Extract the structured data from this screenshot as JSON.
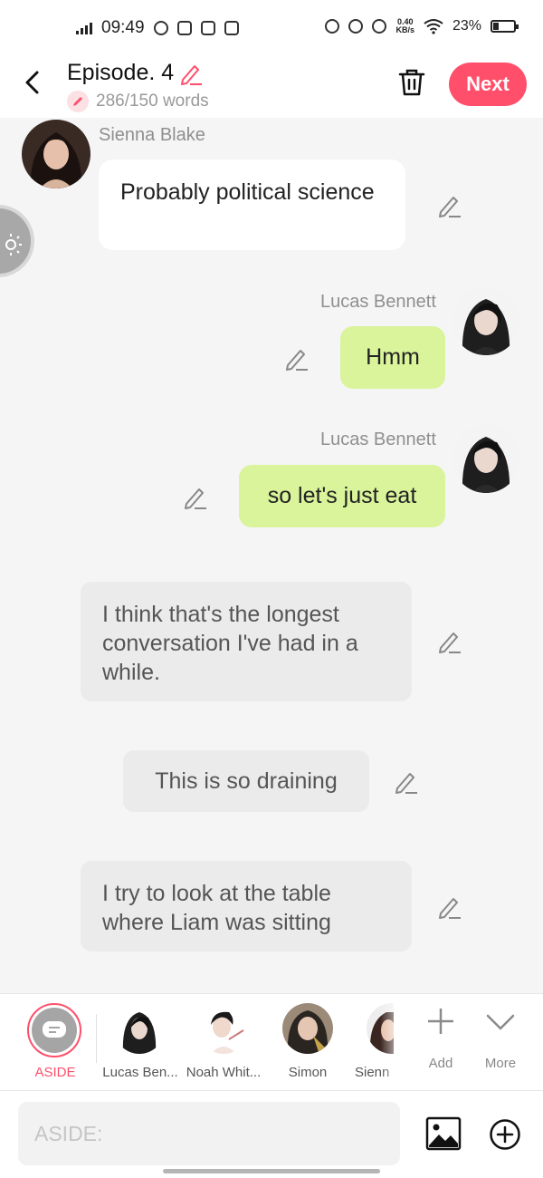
{
  "status_bar": {
    "time": "09:49",
    "net_speed_value": "0.40",
    "net_speed_unit": "KB/s",
    "battery": "23%"
  },
  "header": {
    "title": "Episode. 4",
    "word_count": "286/150 words",
    "next_label": "Next"
  },
  "colors": {
    "accent": "#ff4f6b",
    "green_bubble": "#d9f49a",
    "grey_bubble": "#ebebeb"
  },
  "messages": [
    {
      "type": "character",
      "side": "left",
      "speaker": "Sienna Blake",
      "text": "Probably political science"
    },
    {
      "type": "character",
      "side": "right",
      "speaker": "Lucas Bennett",
      "text": "Hmm"
    },
    {
      "type": "character",
      "side": "right",
      "speaker": "Lucas Bennett",
      "text": "so let's just eat"
    },
    {
      "type": "narration",
      "text": "I think that's the longest conversation I've had in a while."
    },
    {
      "type": "narration",
      "text": "This is so draining"
    },
    {
      "type": "narration",
      "text": "I try to look at the table where Liam was sitting"
    }
  ],
  "character_picker": {
    "aside_label": "ASIDE",
    "characters": [
      "Lucas Ben...",
      "Noah Whit...",
      "Simon",
      "Sienn"
    ],
    "add_label": "Add",
    "more_label": "More"
  },
  "input": {
    "placeholder": "ASIDE:"
  }
}
